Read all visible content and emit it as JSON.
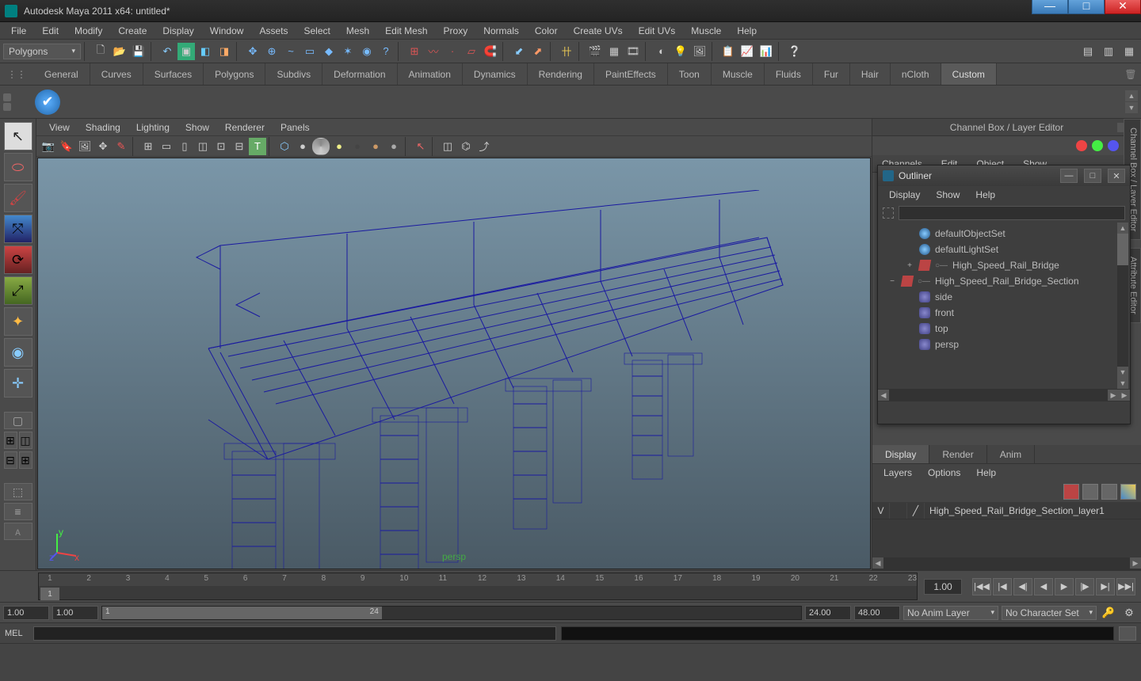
{
  "window": {
    "title": "Autodesk Maya 2011 x64: untitled*"
  },
  "menubar": [
    "File",
    "Edit",
    "Modify",
    "Create",
    "Display",
    "Window",
    "Assets",
    "Select",
    "Mesh",
    "Edit Mesh",
    "Proxy",
    "Normals",
    "Color",
    "Create UVs",
    "Edit UVs",
    "Muscle",
    "Help"
  ],
  "statusline": {
    "module": "Polygons"
  },
  "shelf": {
    "tabs": [
      "General",
      "Curves",
      "Surfaces",
      "Polygons",
      "Subdivs",
      "Deformation",
      "Animation",
      "Dynamics",
      "Rendering",
      "PaintEffects",
      "Toon",
      "Muscle",
      "Fluids",
      "Fur",
      "Hair",
      "nCloth",
      "Custom"
    ],
    "active": "Custom"
  },
  "viewport": {
    "menus": [
      "View",
      "Shading",
      "Lighting",
      "Show",
      "Renderer",
      "Panels"
    ],
    "camera_label": "persp",
    "axes": {
      "x": "x",
      "y": "y",
      "z": "z"
    }
  },
  "channelbox": {
    "title": "Channel Box / Layer Editor",
    "menus": [
      "Channels",
      "Edit",
      "Object",
      "Show"
    ]
  },
  "side_tabs": [
    "Channel Box / Layer Editor",
    "Attribute Editor"
  ],
  "outliner": {
    "title": "Outliner",
    "menus": [
      "Display",
      "Show",
      "Help"
    ],
    "items": [
      {
        "type": "cam",
        "label": "persp",
        "indent": 1
      },
      {
        "type": "cam",
        "label": "top",
        "indent": 1
      },
      {
        "type": "cam",
        "label": "front",
        "indent": 1
      },
      {
        "type": "cam",
        "label": "side",
        "indent": 1
      },
      {
        "type": "grp",
        "label": "High_Speed_Rail_Bridge_Section",
        "indent": 0,
        "exp": "−",
        "conn": true
      },
      {
        "type": "grp",
        "label": "High_Speed_Rail_Bridge",
        "indent": 1,
        "exp": "+",
        "conn": true
      },
      {
        "type": "set",
        "label": "defaultLightSet",
        "indent": 1
      },
      {
        "type": "set",
        "label": "defaultObjectSet",
        "indent": 1
      }
    ]
  },
  "layers": {
    "tabs": [
      "Display",
      "Render",
      "Anim"
    ],
    "active": "Display",
    "menus": [
      "Layers",
      "Options",
      "Help"
    ],
    "rows": [
      {
        "vis": "V",
        "name": "High_Speed_Rail_Bridge_Section_layer1"
      }
    ]
  },
  "timeline": {
    "ticks": [
      "1",
      "2",
      "3",
      "4",
      "5",
      "6",
      "7",
      "8",
      "9",
      "10",
      "11",
      "12",
      "13",
      "14",
      "15",
      "16",
      "17",
      "18",
      "19",
      "20",
      "21",
      "22",
      "23"
    ],
    "current_on_slider": "1",
    "current_frame": "1.00"
  },
  "range": {
    "start_outer": "1.00",
    "start_inner": "1.00",
    "slider_start_label": "1",
    "slider_end_label": "24",
    "end_inner": "24.00",
    "end_outer": "48.00",
    "anim_layer": "No Anim Layer",
    "char_set": "No Character Set"
  },
  "command": {
    "lang": "MEL"
  }
}
